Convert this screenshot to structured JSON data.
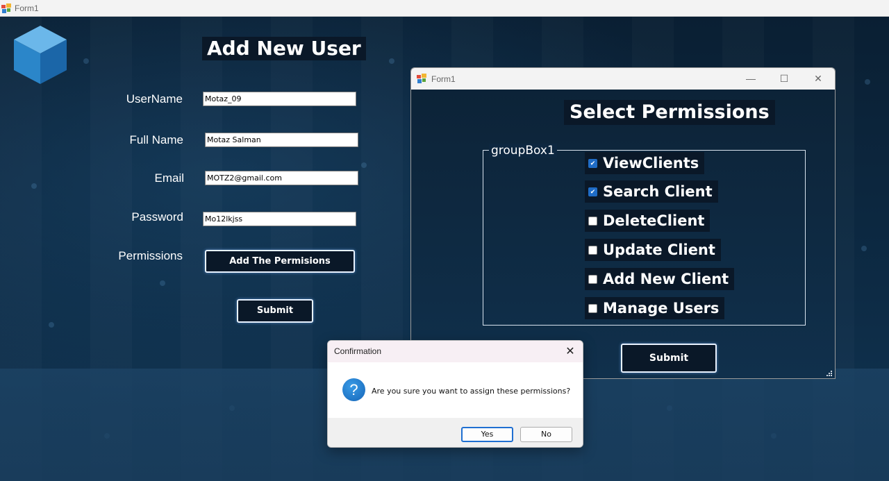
{
  "main_window": {
    "title": "Form1",
    "form_title": "Add New User",
    "fields": {
      "username": {
        "label": "UserName",
        "value": "Motaz_09"
      },
      "full_name": {
        "label": "Full Name",
        "value": "Motaz Salman"
      },
      "email": {
        "label": "Email",
        "value": "MOTZ2@gmail.com"
      },
      "password": {
        "label": "Password",
        "value": "Mo12lkjss"
      },
      "permissions": {
        "label": "Permissions",
        "button": "Add The Permisions"
      }
    },
    "submit_label": "Submit",
    "logo_icon": "cube-icon"
  },
  "permissions_window": {
    "title": "Form1",
    "heading": "Select Permissions",
    "group_label": "groupBox1",
    "permissions": [
      {
        "label": "ViewClients",
        "checked": true
      },
      {
        "label": "Search Client",
        "checked": true
      },
      {
        "label": "DeleteClient",
        "checked": false
      },
      {
        "label": "Update Client",
        "checked": false
      },
      {
        "label": "Add New Client",
        "checked": false
      },
      {
        "label": "Manage Users",
        "checked": false
      }
    ],
    "submit_label": "Submit",
    "controls": {
      "minimize": "—",
      "maximize": "☐",
      "close": "✕"
    }
  },
  "dialog": {
    "title": "Confirmation",
    "message": "Are you sure you want to assign these permissions?",
    "icon": "question-icon",
    "yes_label": "Yes",
    "no_label": "No",
    "close": "✕"
  },
  "colors": {
    "accent": "#1f6cc6",
    "background": "#0b2238"
  }
}
